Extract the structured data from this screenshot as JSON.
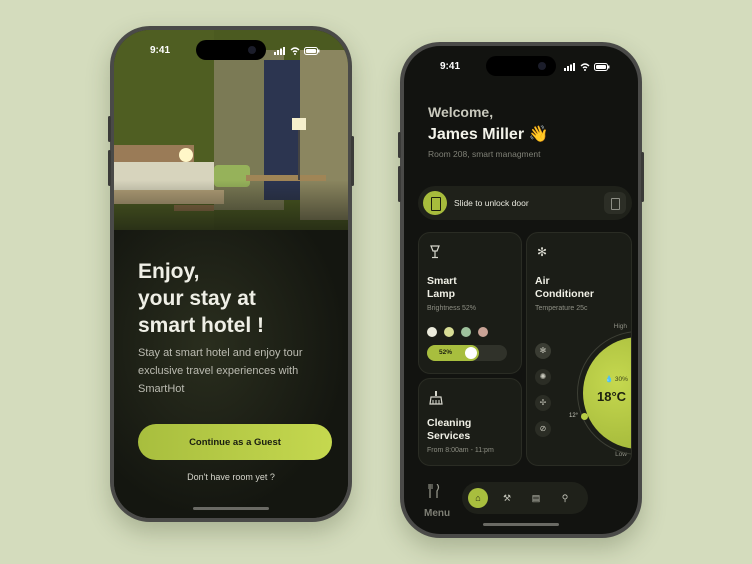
{
  "colors": {
    "accent": "#a8be3e",
    "background": "#d4dcbd",
    "screen": "#121310"
  },
  "onboarding": {
    "status_time": "9:41",
    "headline_line1": "Enjoy,",
    "headline_line2": "your stay at",
    "headline_line3": "smart hotel !",
    "subtitle": "Stay at smart hotel and enjoy tour exclusive travel experiences with SmartHot",
    "guest_button": "Continue as a Guest",
    "no_room_link": "Don't have room yet ?"
  },
  "dashboard": {
    "status_time": "9:41",
    "welcome": "Welcome,",
    "user_name": "James Miller 👋",
    "room_info": "Room 208, smart managment",
    "unlock_label": "Slide to unlock door",
    "lamp": {
      "title_line1": "Smart",
      "title_line2": "Lamp",
      "meta": "Brightness 52%",
      "colors": [
        "#ecebdc",
        "#d8dd95",
        "#9ec19c",
        "#c9a396"
      ],
      "brightness_label": "52%",
      "brightness": 0.52
    },
    "cleaning": {
      "title_line1": "Cleaning",
      "title_line2": "Services",
      "meta": "From 8:00am - 11:pm"
    },
    "ac": {
      "title_line1": "Air",
      "title_line2": "Conditioner",
      "meta": "Temperature 25c",
      "high_label": "High",
      "low_label": "Low",
      "min_label": "12°",
      "temperature": "18°C",
      "humidity": "30%",
      "modes": [
        "snowflake-icon",
        "sun-icon",
        "fan-icon",
        "off-icon"
      ]
    },
    "menu_label": "Menu",
    "nav": [
      "home-icon",
      "service-icon",
      "building-icon",
      "profile-icon"
    ]
  }
}
